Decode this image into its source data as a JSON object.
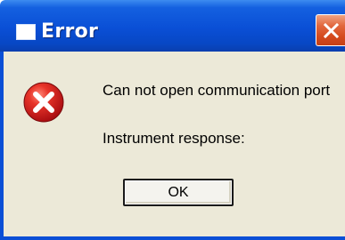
{
  "dialog": {
    "title": "Error",
    "message_line1": "Can not open communication port",
    "message_line2": "Instrument response:",
    "ok_label": "OK"
  },
  "icons": {
    "title_icon": "window-icon",
    "close_icon": "close-icon",
    "message_icon": "error-icon"
  },
  "colors": {
    "titlebar": "#0a4fd6",
    "close_button": "#d54b1e",
    "dialog_body": "#ece9d8",
    "error_icon": "#d4181b"
  }
}
